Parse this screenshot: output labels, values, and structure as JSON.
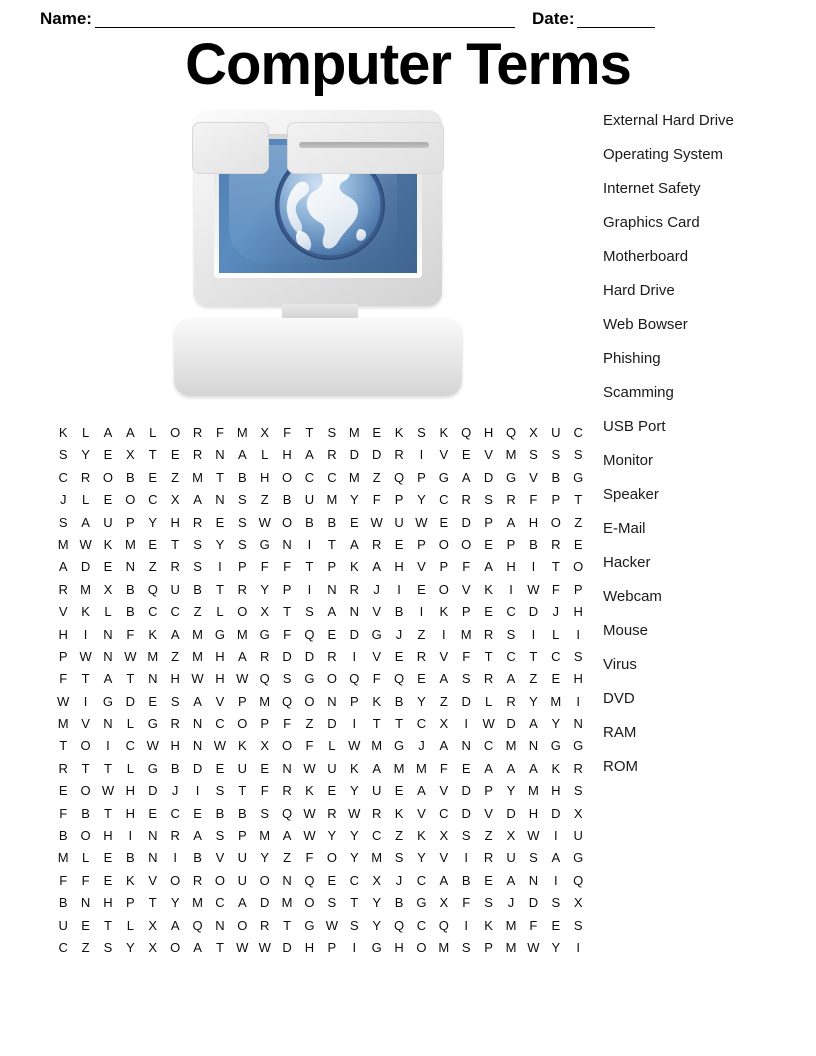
{
  "header": {
    "name_label": "Name:",
    "date_label": "Date:"
  },
  "title": "Computer Terms",
  "illustration": {
    "name": "desktop-computer-with-globe",
    "screen_color": "#4e7db3",
    "case_color": "#e4e4e4"
  },
  "word_list": [
    "External Hard Drive",
    "Operating System",
    "Internet Safety",
    "Graphics Card",
    "Motherboard",
    "Hard Drive",
    "Web Bowser",
    "Phishing",
    "Scamming",
    "USB Port",
    "Monitor",
    "Speaker",
    "E-Mail",
    "Hacker",
    "Webcam",
    "Mouse",
    "Virus",
    "DVD",
    "RAM",
    "ROM"
  ],
  "grid": {
    "rows": 24,
    "cols": 24,
    "letters": [
      "KLAALORFMXFTSMEKSKQHQXUC",
      "SYEXTERNALHARDDRIVEVMSSS",
      "CROBEZMTBHOCCMZQPGADGVBG",
      "JLEOCXANSZBUMYFPYCRSRFPT",
      "SAUPYHRESWOBBEWUWEDPAHOZ",
      "MWKMETSYSGNITAREPOOEPBRE",
      "ADENZRSIPFFTPKAHVPFAHITO",
      "RMXBQUBTRYPINRJIEOVKIWFP",
      "VKLBCCZLOXTSANVBIKPECDJH",
      "HINFKAMGMGFQEDGJZIMRSILI",
      "PWNWMZMHARDDRIVERVFTCTCS",
      "FTATNHWHWQSGOQFQEASRAZEH",
      "WIGDESAVPMQONPKBYZDLRYMI",
      "MVNLGRNCOPFZDITTCXIWDAYN",
      "TOICWHNWKXOFLWMGJANCMNGG",
      "RTTLGBDEUENWUKAMMFEAAAKR",
      "EOWHDJISTFRKEYUEAVDPYMHS",
      "FBTHECEBBSQWRWRKVCDVDHDX",
      "BOHINRASPMAWYYCZKXSZXWIU",
      "MLEBNIBVUYZFOYMSYVIRUSAG",
      "FFEKVOROUONQECXJCABEANIQ",
      "BNHPTYMCADMOSTYBGXFSJDSX",
      "UETLXAQNORTGWSYQCQIKMFES",
      "CZSYXOATWWDHPIGHOMSPMWYI"
    ]
  }
}
